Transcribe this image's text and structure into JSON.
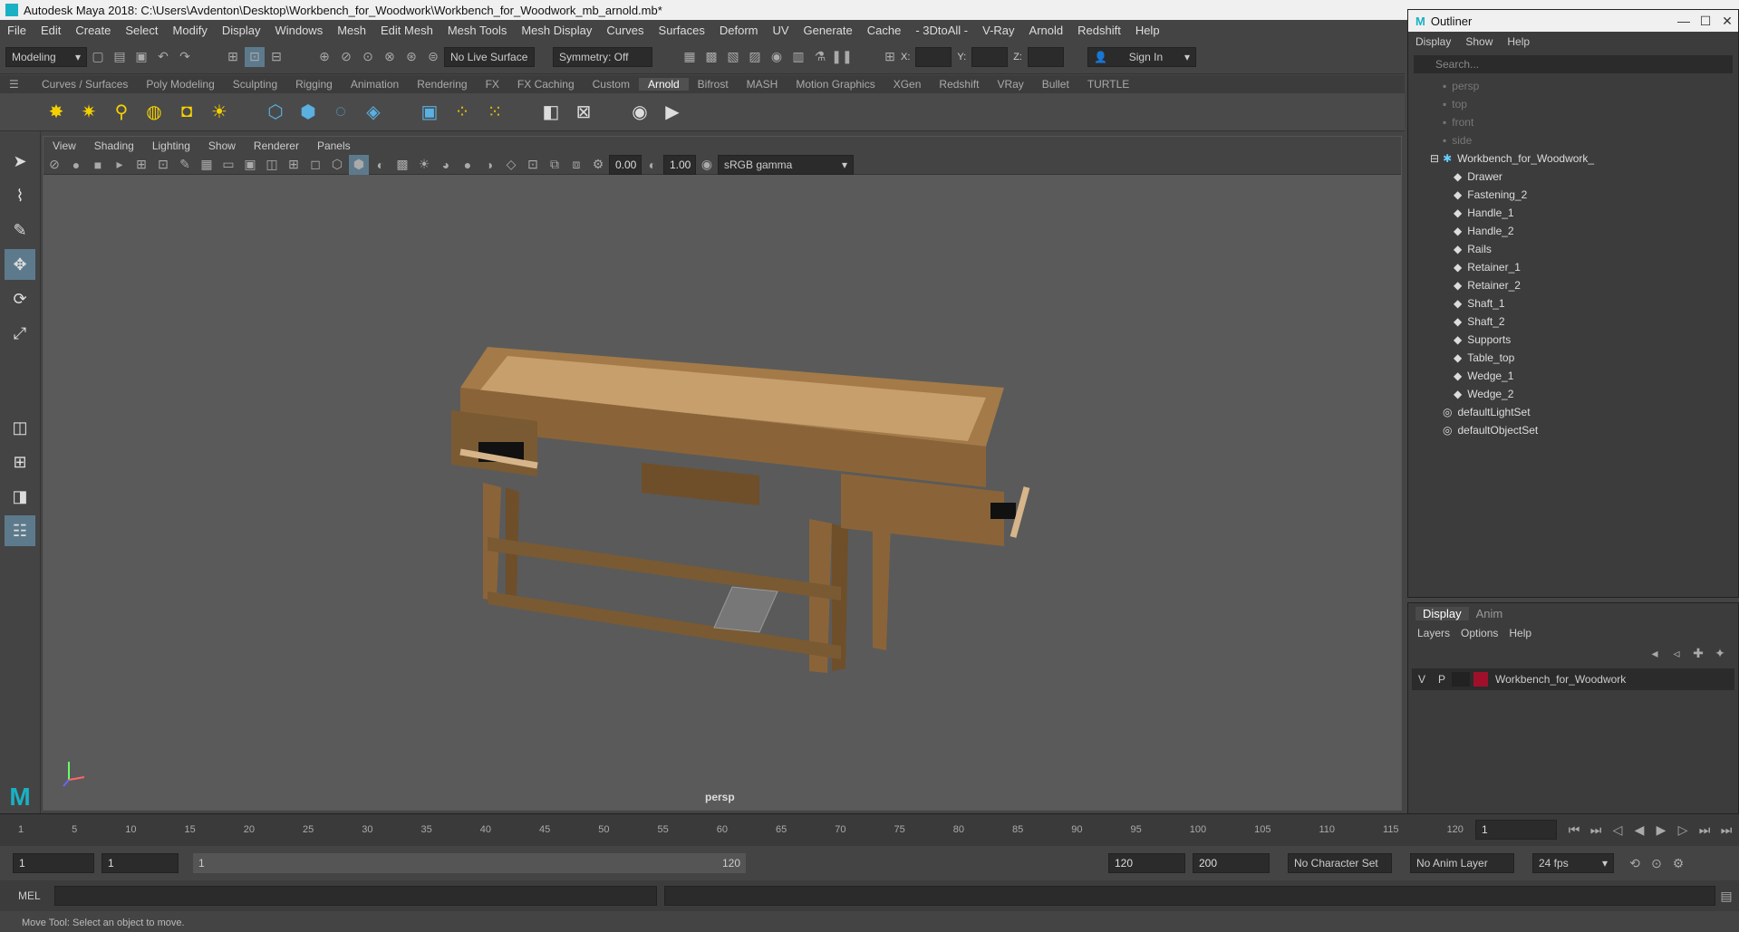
{
  "titlebar": {
    "title": "Autodesk Maya 2018: C:\\Users\\Avdenton\\Desktop\\Workbench_for_Woodwork\\Workbench_for_Woodwork_mb_arnold.mb*"
  },
  "menubar": [
    "File",
    "Edit",
    "Create",
    "Select",
    "Modify",
    "Display",
    "Windows",
    "Mesh",
    "Edit Mesh",
    "Mesh Tools",
    "Mesh Display",
    "Curves",
    "Surfaces",
    "Deform",
    "UV",
    "Generate",
    "Cache",
    "- 3DtoAll -",
    "V-Ray",
    "Arnold",
    "Redshift",
    "Help"
  ],
  "statusline": {
    "mode": "Modeling",
    "live_surface": "No Live Surface",
    "symmetry": "Symmetry: Off",
    "x_label": "X:",
    "y_label": "Y:",
    "z_label": "Z:",
    "sign_in": "Sign In"
  },
  "shelf_tabs": [
    "Curves / Surfaces",
    "Poly Modeling",
    "Sculpting",
    "Rigging",
    "Animation",
    "Rendering",
    "FX",
    "FX Caching",
    "Custom",
    "Arnold",
    "Bifrost",
    "MASH",
    "Motion Graphics",
    "XGen",
    "Redshift",
    "VRay",
    "Bullet",
    "TURTLE"
  ],
  "shelf_active": "Arnold",
  "panel_menu": [
    "View",
    "Shading",
    "Lighting",
    "Show",
    "Renderer",
    "Panels"
  ],
  "panel_tools": {
    "exposure": "0.00",
    "gamma": "1.00",
    "color_space": "sRGB gamma"
  },
  "viewport": {
    "camera_label": "persp"
  },
  "outliner": {
    "title": "Outliner",
    "menu": [
      "Display",
      "Show",
      "Help"
    ],
    "search_placeholder": "Search...",
    "cameras": [
      "persp",
      "top",
      "front",
      "side"
    ],
    "root": "Workbench_for_Woodwork_",
    "children": [
      "Drawer",
      "Fastening_2",
      "Handle_1",
      "Handle_2",
      "Rails",
      "Retainer_1",
      "Retainer_2",
      "Shaft_1",
      "Shaft_2",
      "Supports",
      "Table_top",
      "Wedge_1",
      "Wedge_2"
    ],
    "sets": [
      "defaultLightSet",
      "defaultObjectSet"
    ]
  },
  "layers": {
    "tabs": [
      "Display",
      "Anim"
    ],
    "menu": [
      "Layers",
      "Options",
      "Help"
    ],
    "layer": {
      "v": "V",
      "p": "P",
      "name": "Workbench_for_Woodwork",
      "color": "#a0102a"
    }
  },
  "timeline": {
    "ticks": [
      "5",
      "10",
      "15",
      "20",
      "25",
      "30",
      "35",
      "40",
      "45",
      "50",
      "55",
      "60",
      "65",
      "70",
      "75",
      "80",
      "85",
      "90",
      "95",
      "100",
      "105",
      "110",
      "115",
      "120"
    ],
    "start_marker": "1",
    "current_frame": "1"
  },
  "range": {
    "start": "1",
    "anim_start": "1",
    "range_start": "1",
    "range_end": "120",
    "end": "120",
    "anim_end": "200",
    "char_set": "No Character Set",
    "anim_layer": "No Anim Layer",
    "fps": "24 fps"
  },
  "cmd": {
    "label": "MEL"
  },
  "help": {
    "text": "Move Tool: Select an object to move."
  }
}
